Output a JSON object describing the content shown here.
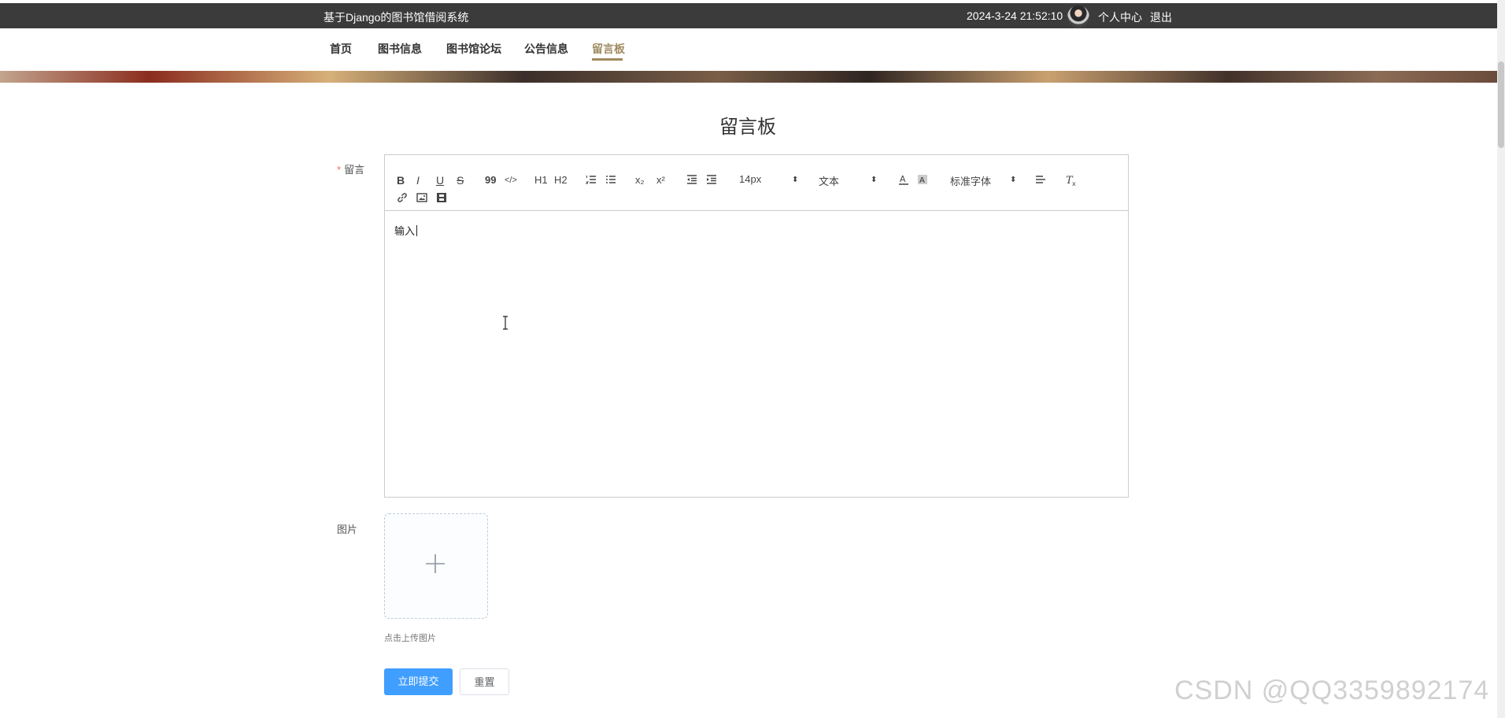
{
  "topbar": {
    "site_title": "基于Django的图书馆借阅系统",
    "datetime": "2024-3-24 21:52:10",
    "user_center": "个人中心",
    "logout": "退出"
  },
  "nav": {
    "items": [
      "首页",
      "图书信息",
      "图书馆论坛",
      "公告信息",
      "留言板"
    ],
    "active": "留言板"
  },
  "page": {
    "title": "留言板"
  },
  "form": {
    "message_label": "留言",
    "required_mark": "*",
    "image_label": "图片",
    "upload_hint": "点击上传图片",
    "submit_label": "立即提交",
    "reset_label": "重置"
  },
  "editor": {
    "content": "输入",
    "toolbar": {
      "bold": "B",
      "italic": "I",
      "underline": "U",
      "strike": "S",
      "quote": "99",
      "code": "</>",
      "h1": "H1",
      "h2": "H2",
      "sub": "x₂",
      "sup": "x²",
      "size": "14px",
      "header": "文本",
      "font": "标准字体"
    },
    "icons": [
      "bold-icon",
      "italic-icon",
      "underline-icon",
      "strike-icon",
      "quote-icon",
      "code-icon",
      "h1-icon",
      "h2-icon",
      "ordered-list-icon",
      "bullet-list-icon",
      "subscript-icon",
      "superscript-icon",
      "outdent-icon",
      "indent-icon",
      "font-color-icon",
      "background-color-icon",
      "align-icon",
      "clear-format-icon",
      "link-icon",
      "image-icon",
      "video-icon"
    ]
  },
  "watermark": "CSDN @QQ3359892174",
  "colors": {
    "accent": "#a08a60",
    "primary": "#409eff",
    "topbar": "#3b3b3b"
  }
}
